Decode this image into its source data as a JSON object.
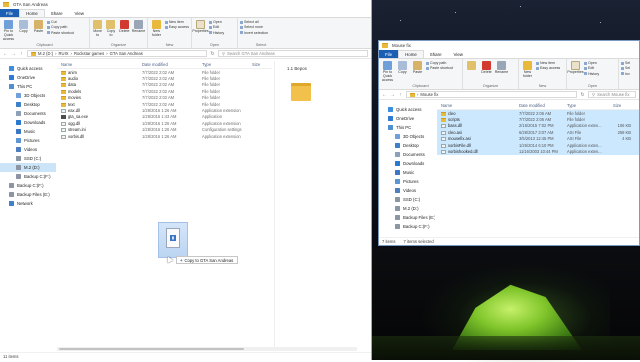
{
  "left_window": {
    "title": "GTA San Andreas",
    "tabs": [
      "File",
      "Home",
      "Share",
      "View"
    ],
    "ribbon": {
      "clipboard": {
        "pin_label": "Pin to Quick access",
        "copy_label": "Copy",
        "paste_label": "Paste",
        "cut_label": "Cut",
        "copy_path_label": "Copy path",
        "paste_shortcut_label": "Paste shortcut",
        "group_label": "Clipboard"
      },
      "organize": {
        "move_label": "Move to",
        "copy_label": "Copy to",
        "delete_label": "Delete",
        "rename_label": "Rename",
        "group_label": "Organize"
      },
      "new": {
        "folder_label": "New folder",
        "item_label": "New item",
        "easy_access_label": "Easy access",
        "group_label": "New"
      },
      "open": {
        "properties_label": "Properties",
        "open_label": "Open",
        "edit_label": "Edit",
        "history_label": "History",
        "group_label": "Open"
      },
      "select": {
        "all_label": "Select all",
        "none_label": "Select none",
        "invert_label": "Invert selection",
        "group_label": "Select"
      }
    },
    "path": [
      "M.2 (D:)",
      "RUIX",
      "Rockstar games",
      "GTA San Andreas"
    ],
    "search_placeholder": "Search GTA San Andreas",
    "nav": [
      {
        "label": "Quick access",
        "icon": "star-icon",
        "indent": false
      },
      {
        "label": "OneDrive",
        "icon": "cloud-icon",
        "indent": false
      },
      {
        "label": "This PC",
        "icon": "pc-icon",
        "indent": false
      },
      {
        "label": "3D Objects",
        "icon": "cube-icon",
        "indent": true
      },
      {
        "label": "Desktop",
        "icon": "desktop-icon",
        "indent": true
      },
      {
        "label": "Documents",
        "icon": "documents-icon",
        "indent": true
      },
      {
        "label": "Downloads",
        "icon": "download-icon",
        "indent": true
      },
      {
        "label": "Music",
        "icon": "music-icon",
        "indent": true
      },
      {
        "label": "Pictures",
        "icon": "pictures-icon",
        "indent": true
      },
      {
        "label": "Videos",
        "icon": "videos-icon",
        "indent": true
      },
      {
        "label": "SSD (C:)",
        "icon": "drive-icon",
        "indent": true
      },
      {
        "label": "M.2 (D:)",
        "icon": "drive-icon",
        "indent": true,
        "selected": true
      },
      {
        "label": "Backup C:(F:)",
        "icon": "drive-icon",
        "indent": true
      },
      {
        "label": "Backup C:(F:)",
        "icon": "drive-icon",
        "indent": false
      },
      {
        "label": "Backup Files (E:)",
        "icon": "drive-icon",
        "indent": false
      },
      {
        "label": "Network",
        "icon": "network-icon",
        "indent": false
      }
    ],
    "columns": [
      "Name",
      "Date modified",
      "Type",
      "Size"
    ],
    "files": [
      {
        "name": "anim",
        "date": "7/7/2022 2:02 AM",
        "type": "File folder",
        "icon": "folder"
      },
      {
        "name": "audio",
        "date": "7/7/2022 2:02 AM",
        "type": "File folder",
        "icon": "folder"
      },
      {
        "name": "data",
        "date": "7/7/2022 2:02 AM",
        "type": "File folder",
        "icon": "folder"
      },
      {
        "name": "models",
        "date": "7/7/2022 2:02 AM",
        "type": "File folder",
        "icon": "folder"
      },
      {
        "name": "movies",
        "date": "7/7/2022 2:02 AM",
        "type": "File folder",
        "icon": "folder"
      },
      {
        "name": "text",
        "date": "7/7/2022 2:02 AM",
        "type": "File folder",
        "icon": "folder"
      },
      {
        "name": "eax.dll",
        "date": "1/28/2016 1:26 AM",
        "type": "Application extension",
        "icon": "file"
      },
      {
        "name": "gta_sa.exe",
        "date": "1/28/2016 1:43 AM",
        "type": "Application",
        "icon": "app"
      },
      {
        "name": "ogg.dll",
        "date": "1/28/2016 1:26 AM",
        "type": "Application extension",
        "icon": "file"
      },
      {
        "name": "stream.ini",
        "date": "1/28/2016 1:26 AM",
        "type": "Configuration settings",
        "icon": "file"
      },
      {
        "name": "vorbis.dll",
        "date": "1/28/2016 1:26 AM",
        "type": "Application extension",
        "icon": "file"
      }
    ],
    "preview_label": "1.1 Bepos",
    "status_items": "11 items"
  },
  "right_window": {
    "title": "Mouse fix",
    "tabs": [
      "File",
      "Home",
      "Share",
      "View"
    ],
    "ribbon": {
      "pin_label": "Pin to Quick access",
      "copy_label": "Copy",
      "paste_label": "Paste",
      "copy_path_label": "Copy path",
      "paste_shortcut_label": "Paste shortcut",
      "clipboard_group": "Clipboard",
      "delete_label": "Delete",
      "rename_label": "Rename",
      "organize_group": "Organize",
      "new_folder_label": "New folder",
      "new_item_label": "New item",
      "easy_access_label": "Easy access",
      "new_group": "New",
      "properties_label": "Properties",
      "open_label": "Open",
      "edit_label": "Edit",
      "history_label": "History",
      "open_group": "Open",
      "select_all_label": "Sel",
      "select_none_label": "Sel",
      "invert_label": "Inv"
    },
    "path": [
      "Mouse fix"
    ],
    "search_placeholder": "Search Mouse fix",
    "nav": [
      {
        "label": "Quick access",
        "icon": "star-icon",
        "indent": false
      },
      {
        "label": "OneDrive",
        "icon": "cloud-icon",
        "indent": false
      },
      {
        "label": "This PC",
        "icon": "pc-icon",
        "indent": false
      },
      {
        "label": "3D Objects",
        "icon": "cube-icon",
        "indent": true
      },
      {
        "label": "Desktop",
        "icon": "desktop-icon",
        "indent": true
      },
      {
        "label": "Documents",
        "icon": "documents-icon",
        "indent": true
      },
      {
        "label": "Downloads",
        "icon": "download-icon",
        "indent": true
      },
      {
        "label": "Music",
        "icon": "music-icon",
        "indent": true
      },
      {
        "label": "Pictures",
        "icon": "pictures-icon",
        "indent": true
      },
      {
        "label": "Videos",
        "icon": "videos-icon",
        "indent": true
      },
      {
        "label": "SSD (C:)",
        "icon": "drive-icon",
        "indent": true
      },
      {
        "label": "M.2 (D:)",
        "icon": "drive-icon",
        "indent": true
      },
      {
        "label": "Backup Files (E:)",
        "icon": "drive-icon",
        "indent": true
      },
      {
        "label": "Backup C:(F:)",
        "icon": "drive-icon",
        "indent": true
      }
    ],
    "columns": [
      "Name",
      "Date modified",
      "Type",
      "Size"
    ],
    "files": [
      {
        "name": "cleo",
        "date": "7/7/2022 2:06 AM",
        "type": "File folder",
        "size": "",
        "icon": "folder"
      },
      {
        "name": "scripts",
        "date": "7/7/2022 2:06 AM",
        "type": "File folder",
        "size": "",
        "icon": "folder"
      },
      {
        "name": "bass.dll",
        "date": "2/16/2015 7:02 PM",
        "type": "Application exten...",
        "size": "106 KB",
        "icon": "file"
      },
      {
        "name": "cleo.asi",
        "date": "6/28/2017 3:07 AM",
        "type": "ASI File",
        "size": "258 KB",
        "icon": "file"
      },
      {
        "name": "mousefix.asi",
        "date": "3/5/2013 12:45 PM",
        "type": "ASI File",
        "size": "4 KB",
        "icon": "file"
      },
      {
        "name": "vorbisFile.dll",
        "date": "1/26/2014 6:10 PM",
        "type": "Application exten...",
        "size": "",
        "icon": "file"
      },
      {
        "name": "vorbishooked.dll",
        "date": "11/16/2003 10:44 PM",
        "type": "Application exten...",
        "size": "",
        "icon": "file"
      }
    ],
    "status_items": "7 items",
    "status_selected": "7 items selected"
  },
  "drag": {
    "tooltip_label": "Copy to GTA San Andreas",
    "tooltip_icon": "plus-icon"
  },
  "colors": {
    "file_tab": "#1a5fb4",
    "selection": "#cce8ff",
    "nav_selected": "#cce4f7",
    "tent_green": "#7fc52a"
  }
}
